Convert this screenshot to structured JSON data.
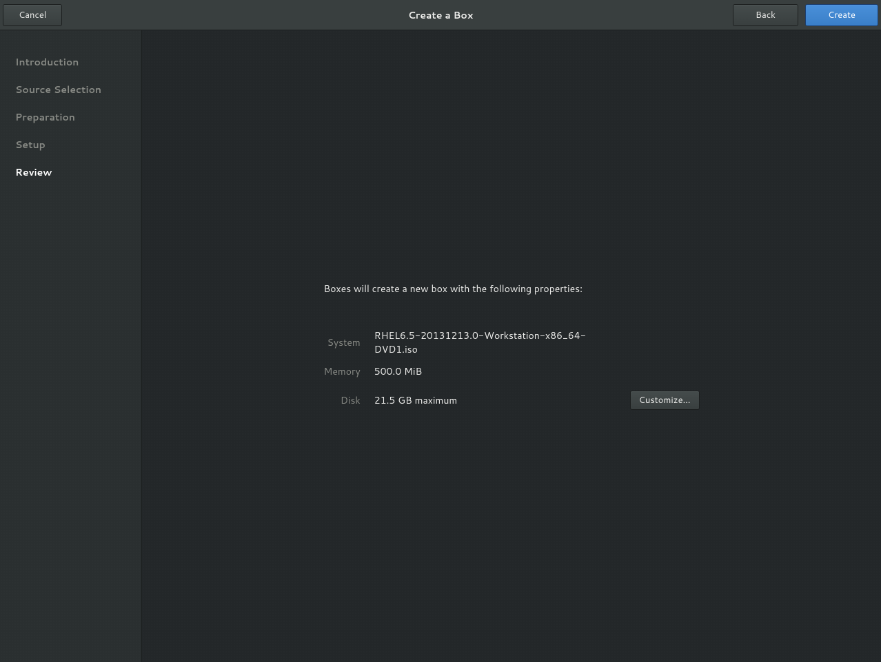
{
  "header": {
    "title": "Create a Box",
    "cancel_label": "Cancel",
    "back_label": "Back",
    "create_label": "Create"
  },
  "sidebar": {
    "items": [
      {
        "label": "Introduction",
        "active": false
      },
      {
        "label": "Source Selection",
        "active": false
      },
      {
        "label": "Preparation",
        "active": false
      },
      {
        "label": "Setup",
        "active": false
      },
      {
        "label": "Review",
        "active": true
      }
    ]
  },
  "review": {
    "intro": "Boxes will create a new box with the following properties:",
    "rows": {
      "system_label": "System",
      "system_value": "RHEL6.5-20131213.0-Workstation-x86_64-DVD1.iso",
      "memory_label": "Memory",
      "memory_value": "500.0 MiB",
      "disk_label": "Disk",
      "disk_value": "21.5 GB maximum",
      "customize_label": "Customize…"
    }
  }
}
